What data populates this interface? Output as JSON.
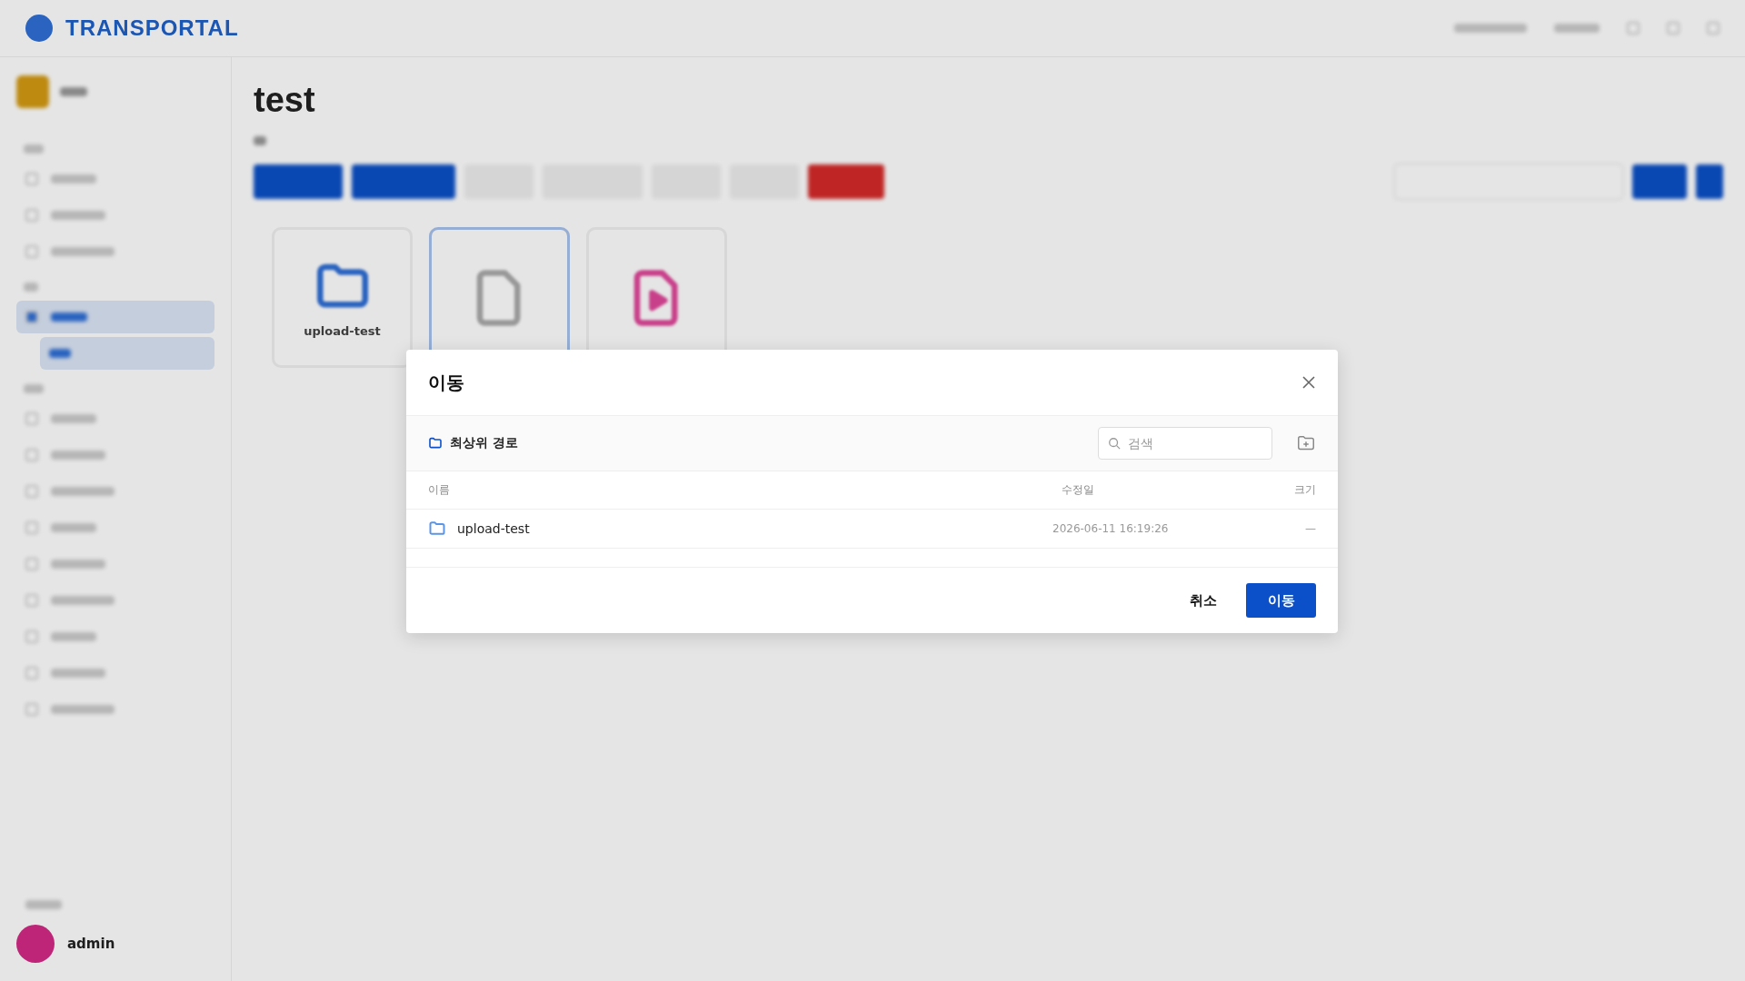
{
  "app": {
    "logo": "TRANSPORTAL"
  },
  "sidebar": {
    "user": {
      "name": "admin"
    }
  },
  "page": {
    "title": "test",
    "items": [
      {
        "kind": "folder",
        "name": "upload-test",
        "selected": false
      },
      {
        "kind": "file",
        "selected": true
      },
      {
        "kind": "video",
        "selected": false
      }
    ]
  },
  "dialog": {
    "title": "이동",
    "path": "최상위 경로",
    "search": {
      "placeholder": "검색"
    },
    "columns": [
      "이름",
      "수정일",
      "크기"
    ],
    "rows": [
      {
        "name": "upload-test",
        "modified": "2026-06-11 16:19:26",
        "size": "—"
      }
    ],
    "buttons": [
      {
        "label": "취소",
        "kind": "secondary"
      },
      {
        "label": "이동",
        "kind": "primary"
      }
    ]
  }
}
